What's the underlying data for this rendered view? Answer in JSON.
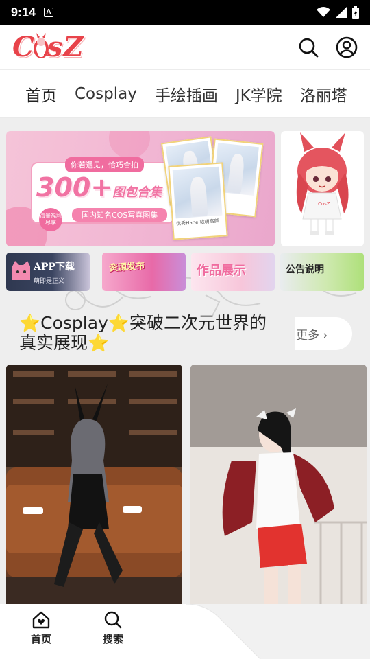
{
  "status_bar": {
    "time": "9:14",
    "notification_icon_letter": "A"
  },
  "header": {
    "logo_text_1": "C",
    "logo_text_2": "sZ",
    "icons": [
      "search-icon",
      "user-icon"
    ]
  },
  "tabs": [
    {
      "label": "首页",
      "active": true
    },
    {
      "label": "Cosplay",
      "active": false
    },
    {
      "label": "手绘插画",
      "active": false
    },
    {
      "label": "JK学院",
      "active": false
    },
    {
      "label": "洛丽塔",
      "active": false
    }
  ],
  "banner": {
    "tagline": "你若遇见，恰巧合拍",
    "big_number": "300+",
    "big_suffix": "图包合集",
    "subtitle": "国内知名COS写真图集",
    "stamp": "海量福利 尽享",
    "polaroid_caption": "优秀Hane 软萌高颜"
  },
  "mini_banners": [
    {
      "title": "APP下载",
      "subtitle": "萌即是正义"
    },
    {
      "title": "资源发布",
      "subtitle": ""
    },
    {
      "title": "作品展示",
      "subtitle": ""
    },
    {
      "title": "公告说明",
      "subtitle": ""
    }
  ],
  "section": {
    "title_part1": "Cosplay",
    "title_part2": "突破二次元世界的",
    "title_line2": "真实展现",
    "star": "⭐",
    "more": "更多 ›"
  },
  "bottom_nav": [
    {
      "label": "首页",
      "icon": "home-heart-icon"
    },
    {
      "label": "搜索",
      "icon": "search-icon"
    }
  ],
  "colors": {
    "brand": "#e8434a",
    "tab_indicator": "#2b4f8c",
    "banner_pink": "#f173a3"
  }
}
